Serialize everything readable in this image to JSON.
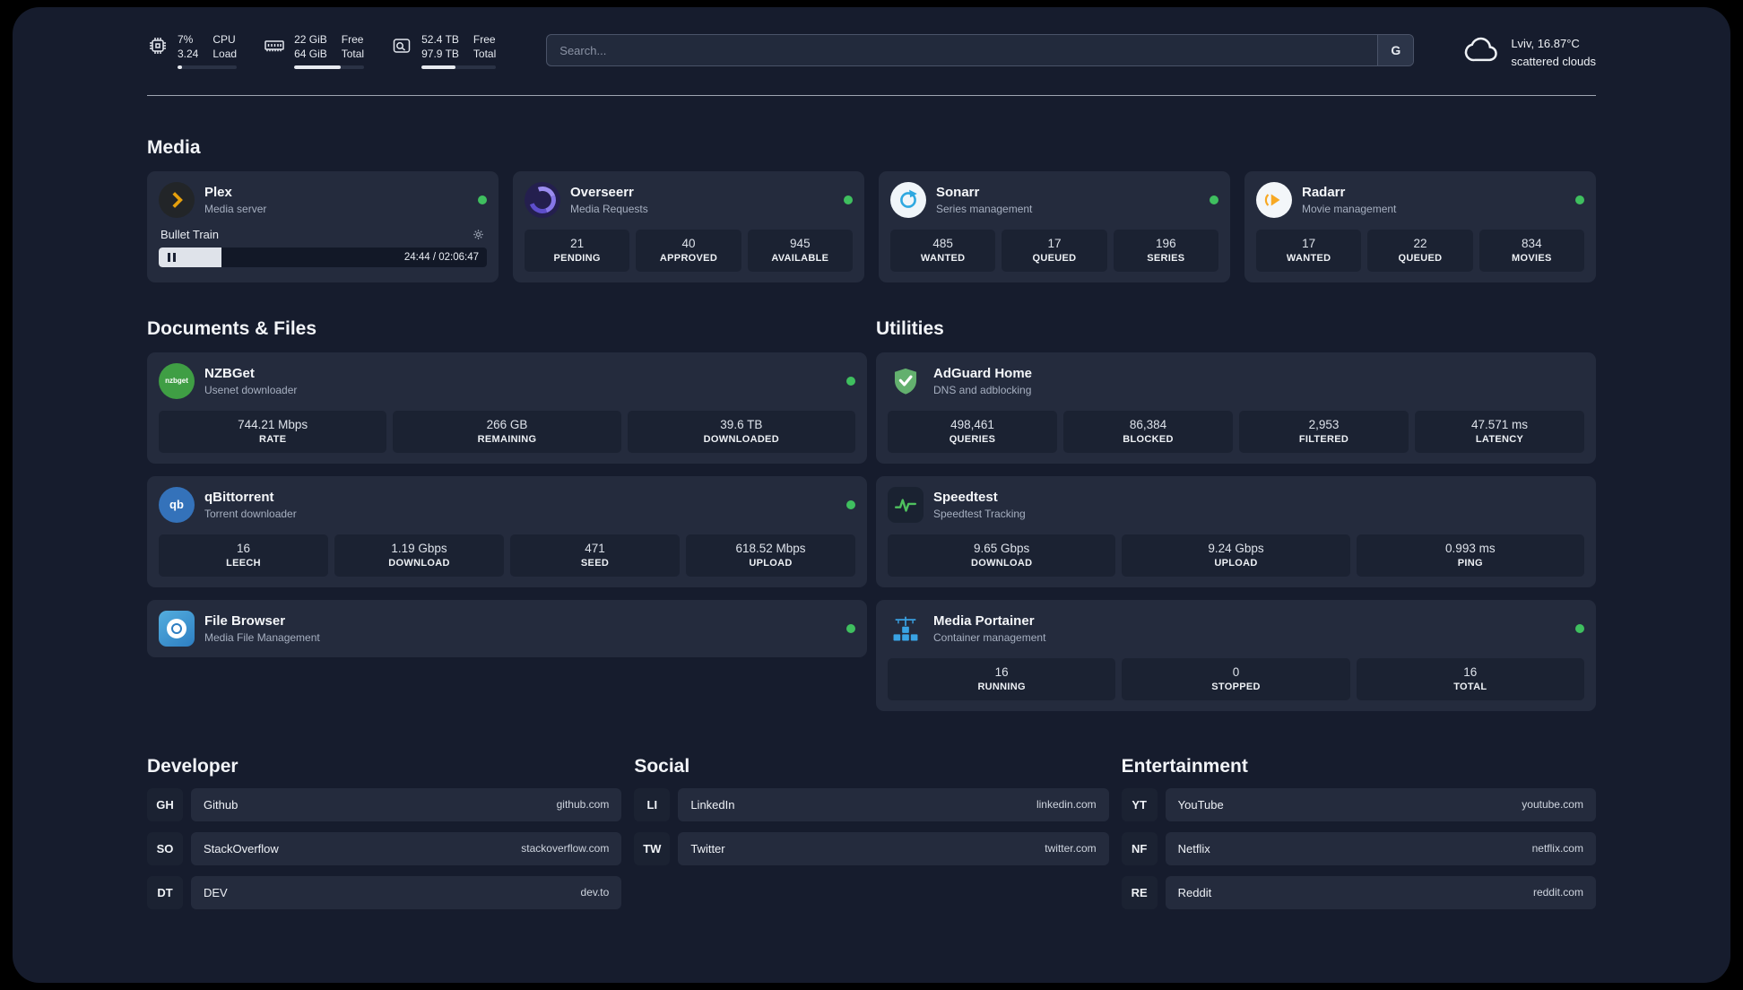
{
  "colors": {
    "panel": "#161c2d",
    "card": "#242b3d",
    "tile": "#1b2232",
    "status-green": "#3fbf5f",
    "plex-amber": "#e5a00d",
    "sonarr-blue": "#2ea8e0",
    "radarr-amber": "#f7a823",
    "nzbget-green": "#3f9e44",
    "qbittorrent-blue": "#3472ba",
    "adguard-green": "#63b06e",
    "filebrowser-blue": "#2d7ec2",
    "portainer-blue": "#39a3e4",
    "speedtest-green": "#4fc15e",
    "overseerr-purple": "#8676e8"
  },
  "topbar": {
    "cpu": {
      "value_top": "7%",
      "value_bottom": "3.24",
      "label_top": "CPU",
      "label_bottom": "Load",
      "bar_percent": 7
    },
    "ram": {
      "value_top": "22 GiB",
      "value_bottom": "64 GiB",
      "label_top": "Free",
      "label_bottom": "Total",
      "bar_percent": 66
    },
    "disk": {
      "value_top": "52.4 TB",
      "value_bottom": "97.9 TB",
      "label_top": "Free",
      "label_bottom": "Total",
      "bar_percent": 46
    },
    "search": {
      "placeholder": "Search...",
      "button": "G"
    },
    "weather": {
      "location": "Lviv, 16.87°C",
      "condition": "scattered clouds"
    }
  },
  "media": {
    "title": "Media",
    "plex": {
      "name": "Plex",
      "subtitle": "Media server",
      "player": {
        "title": "Bullet Train",
        "time": "24:44 / 02:06:47",
        "progress_percent": 19
      }
    },
    "overseerr": {
      "name": "Overseerr",
      "subtitle": "Media Requests",
      "stats": [
        {
          "value": "21",
          "label": "PENDING"
        },
        {
          "value": "40",
          "label": "APPROVED"
        },
        {
          "value": "945",
          "label": "AVAILABLE"
        }
      ]
    },
    "sonarr": {
      "name": "Sonarr",
      "subtitle": "Series management",
      "stats": [
        {
          "value": "485",
          "label": "WANTED"
        },
        {
          "value": "17",
          "label": "QUEUED"
        },
        {
          "value": "196",
          "label": "SERIES"
        }
      ]
    },
    "radarr": {
      "name": "Radarr",
      "subtitle": "Movie management",
      "stats": [
        {
          "value": "17",
          "label": "WANTED"
        },
        {
          "value": "22",
          "label": "QUEUED"
        },
        {
          "value": "834",
          "label": "MOVIES"
        }
      ]
    }
  },
  "documents": {
    "title": "Documents & Files",
    "nzbget": {
      "name": "NZBGet",
      "subtitle": "Usenet downloader",
      "icon_text": "nzbget",
      "stats": [
        {
          "value": "744.21 Mbps",
          "label": "RATE"
        },
        {
          "value": "266 GB",
          "label": "REMAINING"
        },
        {
          "value": "39.6 TB",
          "label": "DOWNLOADED"
        }
      ]
    },
    "qbittorrent": {
      "name": "qBittorrent",
      "subtitle": "Torrent downloader",
      "icon_text": "qb",
      "stats": [
        {
          "value": "16",
          "label": "LEECH"
        },
        {
          "value": "1.19 Gbps",
          "label": "DOWNLOAD"
        },
        {
          "value": "471",
          "label": "SEED"
        },
        {
          "value": "618.52 Mbps",
          "label": "UPLOAD"
        }
      ]
    },
    "filebrowser": {
      "name": "File Browser",
      "subtitle": "Media File Management"
    }
  },
  "utilities": {
    "title": "Utilities",
    "adguard": {
      "name": "AdGuard Home",
      "subtitle": "DNS and adblocking",
      "stats": [
        {
          "value": "498,461",
          "label": "QUERIES"
        },
        {
          "value": "86,384",
          "label": "BLOCKED"
        },
        {
          "value": "2,953",
          "label": "FILTERED"
        },
        {
          "value": "47.571 ms",
          "label": "LATENCY"
        }
      ]
    },
    "speedtest": {
      "name": "Speedtest",
      "subtitle": "Speedtest Tracking",
      "stats": [
        {
          "value": "9.65 Gbps",
          "label": "DOWNLOAD"
        },
        {
          "value": "9.24 Gbps",
          "label": "UPLOAD"
        },
        {
          "value": "0.993 ms",
          "label": "PING"
        }
      ]
    },
    "portainer": {
      "name": "Media Portainer",
      "subtitle": "Container management",
      "stats": [
        {
          "value": "16",
          "label": "RUNNING"
        },
        {
          "value": "0",
          "label": "STOPPED"
        },
        {
          "value": "16",
          "label": "TOTAL"
        }
      ]
    }
  },
  "bookmarks": {
    "developer": {
      "title": "Developer",
      "links": [
        {
          "abbr": "GH",
          "name": "Github",
          "url": "github.com"
        },
        {
          "abbr": "SO",
          "name": "StackOverflow",
          "url": "stackoverflow.com"
        },
        {
          "abbr": "DT",
          "name": "DEV",
          "url": "dev.to"
        }
      ]
    },
    "social": {
      "title": "Social",
      "links": [
        {
          "abbr": "LI",
          "name": "LinkedIn",
          "url": "linkedin.com"
        },
        {
          "abbr": "TW",
          "name": "Twitter",
          "url": "twitter.com"
        }
      ]
    },
    "entertainment": {
      "title": "Entertainment",
      "links": [
        {
          "abbr": "YT",
          "name": "YouTube",
          "url": "youtube.com"
        },
        {
          "abbr": "NF",
          "name": "Netflix",
          "url": "netflix.com"
        },
        {
          "abbr": "RE",
          "name": "Reddit",
          "url": "reddit.com"
        }
      ]
    }
  }
}
